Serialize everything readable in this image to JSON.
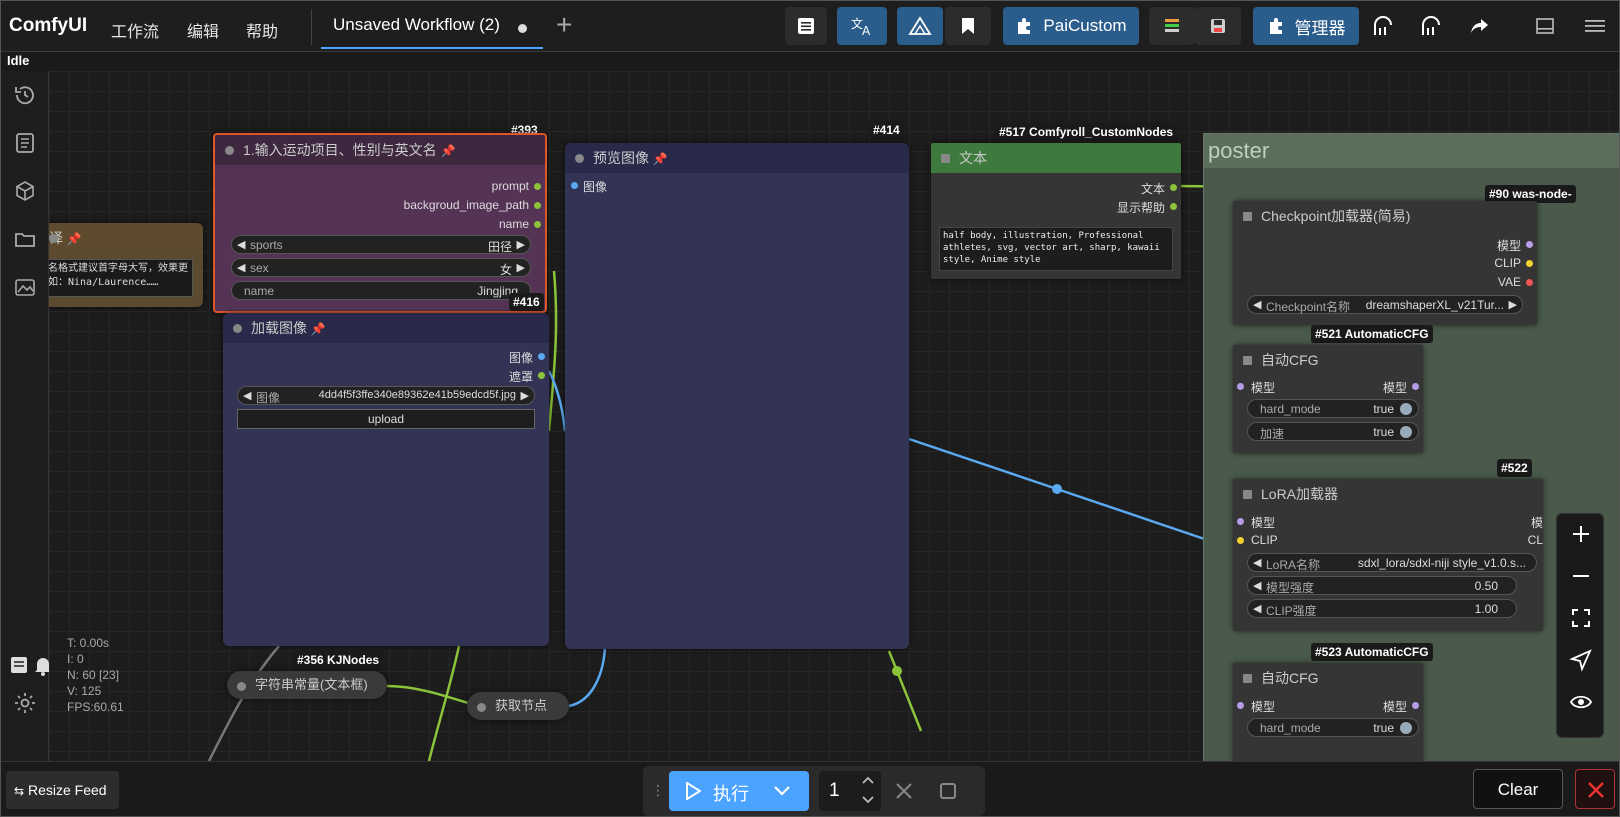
{
  "topbar": {
    "brand": "ComfyUI",
    "menu": [
      "工作流",
      "编辑",
      "帮助"
    ],
    "tab_label": "Unsaved Workflow (2)",
    "pai_custom": "PaiCustom",
    "manager": "管理器"
  },
  "status": "Idle",
  "nodes": {
    "n393": {
      "id": "#393",
      "title": "1.输入运动项目、性别与英文名",
      "outputs": [
        "prompt",
        "backgroud_image_path",
        "name"
      ],
      "sports_label": "sports",
      "sports_value": "田径",
      "sex_label": "sex",
      "sex_value": "女",
      "name_label": "name",
      "name_value": "Jingjing"
    },
    "n416": {
      "id": "#416",
      "title": "加载图像",
      "outputs": [
        "图像",
        "遮罩"
      ],
      "image_label": "图像",
      "image_value": "4dd4f5f3ffe340e89362e41b59edcd5f.jpg",
      "upload": "upload"
    },
    "n414": {
      "id": "#414",
      "title": "预览图像",
      "input": "图像"
    },
    "n517": {
      "id": "#517 Comfyroll_CustomNodes",
      "title": "文本",
      "outputs": [
        "文本",
        "显示帮助"
      ],
      "text": "half body, illustration, Professional athletes, svg, vector art, sharp, kawaii style, Anime style"
    },
    "left_note": {
      "title": "译",
      "text": "名格式建议首字母大写，效果更\n如：Nina/Laurence……"
    },
    "group_title": "poster",
    "n90": {
      "id": "#90 was-node-"
    },
    "ckpt": {
      "title": "Checkpoint加载器(简易)",
      "outputs": [
        "模型",
        "CLIP",
        "VAE"
      ],
      "label": "Checkpoint名称",
      "value": "dreamshaperXL_v21Tur..."
    },
    "n521": {
      "id": "#521 AutomaticCFG",
      "title": "自动CFG",
      "in": "模型",
      "out": "模型",
      "w1_label": "hard_mode",
      "w1_value": "true",
      "w2_label": "加速",
      "w2_value": "true"
    },
    "n522": {
      "id": "#522",
      "title": "LoRA加载器",
      "inputs": [
        "模型",
        "CLIP"
      ],
      "outputs": [
        "模",
        "CL"
      ],
      "lora_label": "LoRA名称",
      "lora_value": "sdxl_lora/sdxl-niji style_v1.0.s...",
      "ms_label": "模型强度",
      "ms_value": "0.50",
      "cs_label": "CLIP强度",
      "cs_value": "1.00"
    },
    "n523": {
      "id": "#523 AutomaticCFG",
      "title": "自动CFG",
      "in": "模型",
      "out": "模型",
      "w1_label": "hard_mode",
      "w1_value": "true"
    },
    "n356": {
      "id": "#356 KJNodes",
      "title": "字符串常量(文本框)"
    },
    "get_node": {
      "title": "获取节点"
    }
  },
  "stats": {
    "t": "T: 0.00s",
    "i": "I: 0",
    "n": "N: 60 [23]",
    "v": "V: 125",
    "fps": "FPS:60.61"
  },
  "bottom": {
    "resize_feed": "Resize Feed",
    "run_label": "执行",
    "batch_count": "1",
    "clear": "Clear"
  },
  "colors": {
    "accent": "#4aa3ff",
    "selected_outline": "#e0552b",
    "wire_green": "#8bc33a",
    "wire_blue": "#5aa9f0",
    "wire_yellow": "#f2d230",
    "wire_purple": "#b79ce8"
  }
}
